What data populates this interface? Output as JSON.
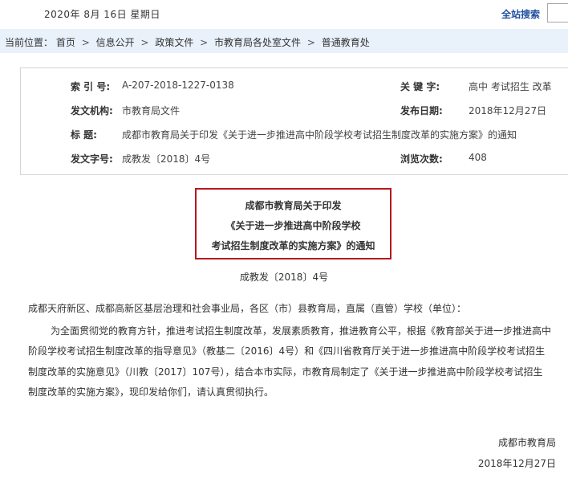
{
  "header": {
    "date": "2020年 8月 16日 星期日",
    "search_link": "全站搜索"
  },
  "breadcrumb": {
    "prefix": "当前位置：",
    "items": [
      "首页",
      "信息公开",
      "政策文件",
      "市教育局各处室文件",
      "普通教育处"
    ],
    "separator": ">"
  },
  "meta": {
    "index_label": "索  引  号:",
    "index_value": "A-207-2018-1227-0138",
    "keywords_label": "关  键  字:",
    "keywords_value": "高中 考试招生 改革",
    "issuer_label": "发文机构:",
    "issuer_value": "市教育局文件",
    "publish_label": "发布日期:",
    "publish_value": "2018年12月27日",
    "title_label": "标      题:",
    "title_value": "成都市教育局关于印发《关于进一步推进高中阶段学校考试招生制度改革的实施方案》的通知",
    "docno_label": "发文字号:",
    "docno_value": "成教发〔2018〕4号",
    "views_label": "浏览次数:",
    "views_value": "408"
  },
  "document": {
    "title_line1": "成都市教育局关于印发",
    "title_line2": "《关于进一步推进高中阶段学校",
    "title_line3": "考试招生制度改革的实施方案》的通知",
    "doc_number": "成教发〔2018〕4号",
    "salutation": "成都天府新区、成都高新区基层治理和社会事业局，各区（市）县教育局，直属（直管）学校（单位）：",
    "body_lines": [
      "为全面贯彻党的教育方针，推进考试招生制度改革，发展素质教育，推进教育公平，根据《教育部关于进一步推进高中",
      "阶段学校考试招生制度改革的指导意见》（教基二〔2016〕4号）和《四川省教育厅关于进一步推进高中阶段学校考试招生",
      "制度改革的实施意见》（川教〔2017〕107号），结合本市实际，市教育局制定了《关于进一步推进高中阶段学校考试招生",
      "制度改革的实施方案》，现印发给你们，请认真贯彻执行。"
    ],
    "signature": "成都市教育局",
    "sign_date": "2018年12月27日"
  }
}
